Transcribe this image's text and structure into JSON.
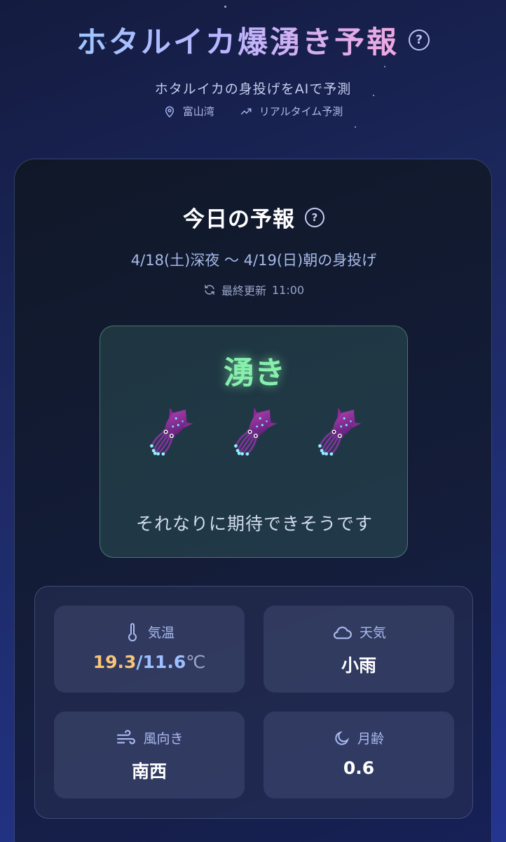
{
  "header": {
    "title": "ホタルイカ爆湧き予報",
    "subtitle": "ホタルイカの身投げをAIで予測",
    "location": "富山湾",
    "mode": "リアルタイム予測"
  },
  "forecast": {
    "heading": "今日の予報",
    "date_range": "4/18(土)深夜 〜 4/19(日)朝の身投げ",
    "updated_label": "最終更新",
    "updated_time": "11:00",
    "level_label": "湧き",
    "squid_count": 3,
    "comment": "それなりに期待できそうです"
  },
  "conditions": {
    "temperature": {
      "label": "気温",
      "high": "19.3",
      "separator": "/",
      "low": "11.6",
      "unit": "℃"
    },
    "weather": {
      "label": "天気",
      "value": "小雨"
    },
    "wind": {
      "label": "風向き",
      "value": "南西"
    },
    "moon": {
      "label": "月齢",
      "value": "0.6"
    }
  },
  "colors": {
    "level_green": "#86efac",
    "temp_high": "#f7c47a",
    "temp_low": "#9ec0ff",
    "accent_label": "#a9bbf0"
  },
  "icons": [
    "help-icon",
    "location-pin-icon",
    "trending-up-icon",
    "refresh-icon",
    "squid-icon",
    "thermometer-icon",
    "cloud-icon",
    "wind-icon",
    "moon-icon"
  ]
}
